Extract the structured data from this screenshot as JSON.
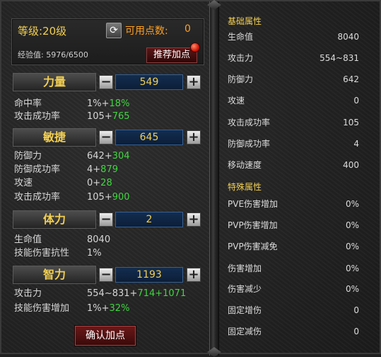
{
  "header": {
    "level": "等级:20级",
    "points_label": "可用点数:",
    "points_value": "0",
    "exp": "经验值: 5976/6500",
    "recommend_label": "推荐加点"
  },
  "attributes": [
    {
      "name": "力量",
      "value": "549",
      "stats": [
        {
          "label": "命中率",
          "base": "1%+",
          "bonus": "18%"
        },
        {
          "label": "攻击成功率",
          "base": "105+",
          "bonus": "765"
        }
      ]
    },
    {
      "name": "敏捷",
      "value": "645",
      "stats": [
        {
          "label": "防御力",
          "base": "642+",
          "bonus": "304"
        },
        {
          "label": "防御成功率",
          "base": "4+",
          "bonus": "879"
        },
        {
          "label": "攻速",
          "base": "0+",
          "bonus": "28"
        },
        {
          "label": "攻击成功率",
          "base": "105+",
          "bonus": "900"
        }
      ]
    },
    {
      "name": "体力",
      "value": "2",
      "stats": [
        {
          "label": "生命值",
          "base": "8040",
          "bonus": ""
        },
        {
          "label": "技能伤害抗性",
          "base": "1%",
          "bonus": ""
        }
      ]
    },
    {
      "name": "智力",
      "value": "1193",
      "stats": [
        {
          "label": "攻击力",
          "base": "554~831+",
          "bonus": "714+1071"
        },
        {
          "label": "技能伤害增加",
          "base": "1%+",
          "bonus": "32%"
        }
      ]
    }
  ],
  "confirm_label": "确认加点",
  "basic": {
    "title": "基础属性",
    "rows": [
      {
        "label": "生命值",
        "value": "8040"
      },
      {
        "label": "攻击力",
        "value": "554~831"
      },
      {
        "label": "防御力",
        "value": "642"
      },
      {
        "label": "攻速",
        "value": "0"
      },
      {
        "label": "攻击成功率",
        "value": "105"
      },
      {
        "label": "防御成功率",
        "value": "4"
      },
      {
        "label": "移动速度",
        "value": "400"
      }
    ]
  },
  "special": {
    "title": "特殊属性",
    "rows": [
      {
        "label": "PVE伤害增加",
        "value": "0%"
      },
      {
        "label": "PVP伤害增加",
        "value": "0%"
      },
      {
        "label": "PVP伤害减免",
        "value": "0%"
      },
      {
        "label": "伤害增加",
        "value": "0%"
      },
      {
        "label": "伤害减少",
        "value": "0%"
      },
      {
        "label": "固定增伤",
        "value": "0"
      },
      {
        "label": "固定减伤",
        "value": "0"
      }
    ]
  },
  "colors": {
    "gold": "#f2cf52",
    "orange": "#ffa020",
    "green": "#40d640",
    "value_box": "#132d4f"
  }
}
